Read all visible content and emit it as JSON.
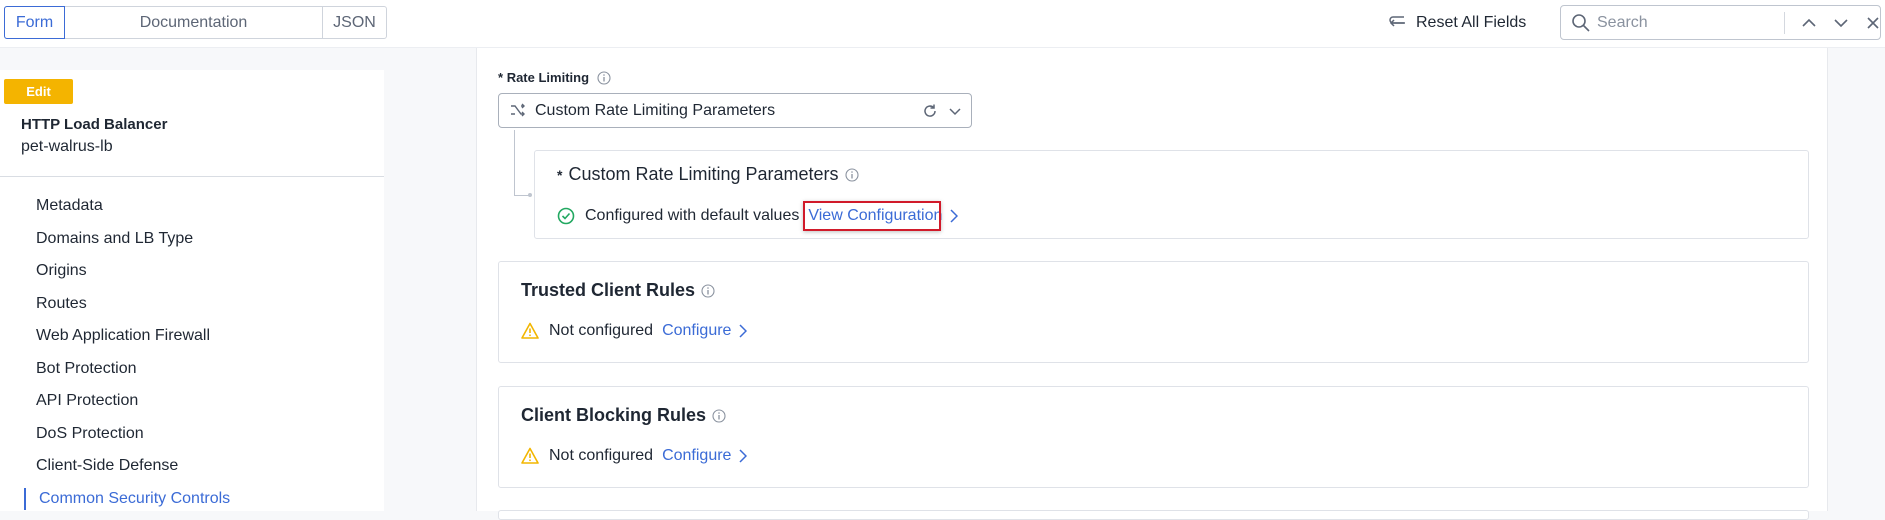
{
  "tabs": [
    "Form",
    "Documentation",
    "JSON"
  ],
  "toolbar": {
    "reset_label": "Reset All Fields"
  },
  "search": {
    "placeholder": "Search"
  },
  "sidebar": {
    "badge": "Edit",
    "object_type": "HTTP Load Balancer",
    "object_name": "pet-walrus-lb",
    "items": [
      "Metadata",
      "Domains and LB Type",
      "Origins",
      "Routes",
      "Web Application Firewall",
      "Bot Protection",
      "API Protection",
      "DoS Protection",
      "Client-Side Defense",
      "Common Security Controls"
    ],
    "active_item": "Common Security Controls"
  },
  "form": {
    "rate_limiting": {
      "required_mark": "*",
      "label": "Rate Limiting",
      "selected": "Custom Rate Limiting Parameters"
    },
    "custom_params": {
      "required_mark": "*",
      "title": "Custom Rate Limiting Parameters",
      "status": "Configured with default values",
      "link": "View Configuration"
    },
    "trusted_client_rules": {
      "title": "Trusted Client Rules",
      "status": "Not configured",
      "link": "Configure"
    },
    "client_blocking_rules": {
      "title": "Client Blocking Rules",
      "status": "Not configured",
      "link": "Configure"
    }
  },
  "colors": {
    "accent": "#3b6bd6",
    "badge": "#f4b400",
    "success": "#22a861",
    "warning": "#f2b600",
    "highlight": "#d11a2a"
  }
}
